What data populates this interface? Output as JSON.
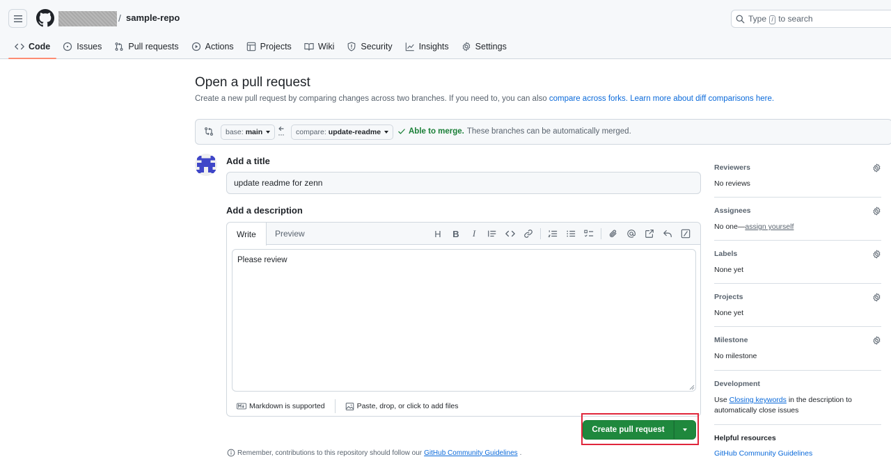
{
  "header": {
    "repo_separator": "/",
    "repo_name": "sample-repo",
    "search": {
      "prefix": "Type",
      "key": "/",
      "suffix": "to search"
    }
  },
  "nav": {
    "code": "Code",
    "issues": "Issues",
    "pull_requests": "Pull requests",
    "actions": "Actions",
    "projects": "Projects",
    "wiki": "Wiki",
    "security": "Security",
    "insights": "Insights",
    "settings": "Settings"
  },
  "main": {
    "title": "Open a pull request",
    "subtitle_prefix": "Create a new pull request by comparing changes across two branches. If you need to, you can also",
    "compare_forks_link": "compare across forks.",
    "learn_more_link": "Learn more about diff comparisons here.",
    "base_label": "base:",
    "base_branch": "main",
    "compare_label": "compare:",
    "compare_branch": "update-readme",
    "merge_ok": "Able to merge.",
    "merge_msg": "These branches can be automatically merged.",
    "title_label": "Add a title",
    "title_value": "update readme for zenn",
    "desc_label": "Add a description",
    "tab_write": "Write",
    "tab_preview": "Preview",
    "toolbar_heading": "H",
    "toolbar_bold": "B",
    "toolbar_italic": "I",
    "description_value": "Please review",
    "markdown_note": "Markdown is supported",
    "attach_note": "Paste, drop, or click to add files",
    "create_button": "Create pull request",
    "reminder_prefix": "Remember, contributions to this repository should follow our",
    "reminder_link": "GitHub Community Guidelines",
    "reminder_suffix": "."
  },
  "sidebar": {
    "reviewers": {
      "label": "Reviewers",
      "value": "No reviews"
    },
    "assignees": {
      "label": "Assignees",
      "value_prefix": "No one—",
      "value_link": "assign yourself"
    },
    "labels": {
      "label": "Labels",
      "value": "None yet"
    },
    "projects": {
      "label": "Projects",
      "value": "None yet"
    },
    "milestone": {
      "label": "Milestone",
      "value": "No milestone"
    },
    "development": {
      "label": "Development",
      "value_prefix": "Use",
      "value_link": "Closing keywords",
      "value_suffix": "in the description to automatically close issues"
    },
    "helpful": {
      "label": "Helpful resources",
      "link": "GitHub Community Guidelines"
    }
  },
  "colors": {
    "primary_button": "#1f883d",
    "link": "#0969da",
    "highlight_box": "#e0263b",
    "merge_ok": "#1a7f37",
    "active_tab_underline": "#fd8c73"
  }
}
